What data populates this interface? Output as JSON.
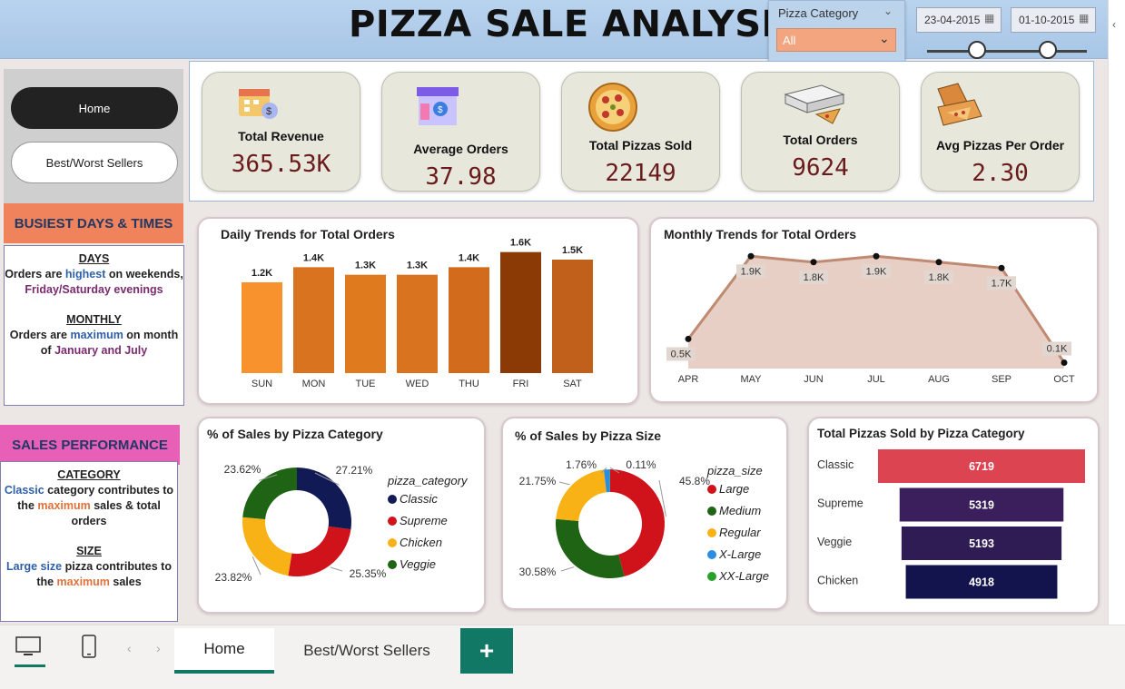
{
  "header": {
    "title": "PIZZA SALE ANALYSIS",
    "category_slicer": {
      "label": "Pizza Category",
      "value": "All"
    },
    "date_start": "23-04-2015",
    "date_end": "01-10-2015"
  },
  "nav": {
    "home": "Home",
    "best_worst": "Best/Worst Sellers"
  },
  "busiest": {
    "header": "BUSIEST DAYS & TIMES",
    "days_h": "DAYS",
    "days_1": "Orders are ",
    "days_1b": "highest",
    "days_1c": " on weekends, ",
    "days_1d": "Friday/Saturday evenings",
    "monthly_h": "MONTHLY",
    "monthly_1": "Orders are ",
    "monthly_1b": "maximum",
    "monthly_1c": " on month of ",
    "monthly_1d": "January and July"
  },
  "sales": {
    "header": "SALES PERFORMANCE",
    "cat_h": "CATEGORY",
    "cat_1": "Classic",
    "cat_2": "  category contributes to the ",
    "cat_3": "maximum",
    "cat_4": " sales & total orders",
    "size_h": "SIZE",
    "size_1": "Large size",
    "size_2": " pizza contributes to the ",
    "size_3": "maximum",
    "size_4": " sales"
  },
  "kpis": [
    {
      "label": "Total Revenue",
      "value": "365.53K",
      "icon": "calendar-money-icon"
    },
    {
      "label": "Average Orders",
      "value": "37.98",
      "icon": "storefront-icon"
    },
    {
      "label": "Total Pizzas Sold",
      "value": "22149",
      "icon": "pizza-icon"
    },
    {
      "label": "Total Orders",
      "value": "9624",
      "icon": "pizza-box-icon"
    },
    {
      "label": "Avg Pizzas Per Order",
      "value": "2.30",
      "icon": "open-box-icon"
    }
  ],
  "daily": {
    "title": "Daily Trends for Total Orders"
  },
  "monthly": {
    "title": "Monthly Trends for Total Orders"
  },
  "cat_donut": {
    "title": "% of Sales by Pizza Category",
    "legend_title": "pizza_category"
  },
  "size_donut": {
    "title": "% of Sales by Pizza Size",
    "legend_title": "pizza_size"
  },
  "funnel": {
    "title": "Total Pizzas Sold by Pizza Category"
  },
  "tabs": {
    "home": "Home",
    "best_worst": "Best/Worst Sellers",
    "add": "+"
  },
  "colors": {
    "accent": "#117865",
    "header": "#b9d3ee",
    "kpi": "#e8e7dc"
  },
  "chart_data": [
    {
      "type": "bar",
      "title": "Daily Trends for Total Orders",
      "categories": [
        "SUN",
        "MON",
        "TUE",
        "WED",
        "THU",
        "FRI",
        "SAT"
      ],
      "values": [
        1200,
        1400,
        1300,
        1300,
        1400,
        1600,
        1500
      ],
      "labels": [
        "1.2K",
        "1.4K",
        "1.3K",
        "1.3K",
        "1.4K",
        "1.6K",
        "1.5K"
      ],
      "colors": [
        "#f7922c",
        "#d9731f",
        "#e07a1f",
        "#d9731f",
        "#d26b1c",
        "#8b3a05",
        "#c1601b"
      ]
    },
    {
      "type": "area",
      "title": "Monthly Trends for Total Orders",
      "categories": [
        "APR",
        "MAY",
        "JUN",
        "JUL",
        "AUG",
        "SEP",
        "OCT"
      ],
      "values": [
        500,
        1900,
        1800,
        1900,
        1800,
        1700,
        100
      ],
      "labels": [
        "0.5K",
        "1.9K",
        "1.8K",
        "1.9K",
        "1.8K",
        "1.7K",
        "0.1K"
      ],
      "color": "#c08a72"
    },
    {
      "type": "pie",
      "title": "% of Sales by Pizza Category",
      "series": [
        {
          "name": "Classic",
          "value": 27.21,
          "label": "27.21%",
          "color": "#111a55"
        },
        {
          "name": "Supreme",
          "value": 25.35,
          "label": "25.35%",
          "color": "#d0121b"
        },
        {
          "name": "Chicken",
          "value": 23.82,
          "label": "23.82%",
          "color": "#f8b216"
        },
        {
          "name": "Veggie",
          "value": 23.62,
          "label": "23.62%",
          "color": "#1f6315"
        }
      ]
    },
    {
      "type": "pie",
      "title": "% of Sales by Pizza Size",
      "series": [
        {
          "name": "Large",
          "value": 45.8,
          "label": "45.8%",
          "color": "#d0121b"
        },
        {
          "name": "Medium",
          "value": 30.58,
          "label": "30.58%",
          "color": "#1f6315"
        },
        {
          "name": "Regular",
          "value": 21.75,
          "label": "21.75%",
          "color": "#f8b216"
        },
        {
          "name": "X-Large",
          "value": 1.76,
          "label": "1.76%",
          "color": "#2a8de0"
        },
        {
          "name": "XX-Large",
          "value": 0.11,
          "label": "0.11%",
          "color": "#2aa02a"
        }
      ]
    },
    {
      "type": "bar",
      "title": "Total Pizzas Sold by Pizza Category",
      "categories": [
        "Classic",
        "Supreme",
        "Veggie",
        "Chicken"
      ],
      "values": [
        6719,
        5319,
        5193,
        4918
      ],
      "colors": [
        "#dc4452",
        "#3a1f5c",
        "#2f1c55",
        "#13134e"
      ]
    }
  ]
}
